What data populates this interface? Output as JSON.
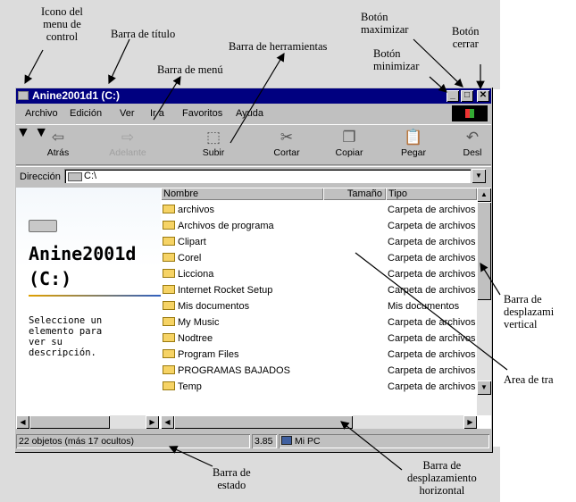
{
  "window": {
    "title": "Anine2001d1 (C:)",
    "buttons": {
      "minimize": "_",
      "maximize": "□",
      "close": "✕"
    }
  },
  "menu": [
    "Archivo",
    "Edición",
    "Ver",
    "Ir a",
    "Favoritos",
    "Ayuda"
  ],
  "toolbar": [
    {
      "label": "Atrás",
      "icon": "back-arrow-icon",
      "glyph": "⇦",
      "disabled": false
    },
    {
      "label": "Adelante",
      "icon": "forward-arrow-icon",
      "glyph": "⇨",
      "disabled": true
    },
    {
      "label": "Subir",
      "icon": "up-folder-icon",
      "glyph": "⬚",
      "disabled": false
    },
    {
      "label": "Cortar",
      "icon": "scissors-icon",
      "glyph": "✂",
      "disabled": false
    },
    {
      "label": "Copiar",
      "icon": "copy-icon",
      "glyph": "❐",
      "disabled": false
    },
    {
      "label": "Pegar",
      "icon": "paste-icon",
      "glyph": "📋",
      "disabled": false
    },
    {
      "label": "Desl",
      "icon": "undo-icon",
      "glyph": "↶",
      "disabled": false
    }
  ],
  "address": {
    "label": "Dirección",
    "value": "C:\\"
  },
  "webview": {
    "heading_line1": "Anine2001d",
    "heading_line2": "(C:)",
    "description": "Seleccione un\nelemento para\nver su\ndescripción."
  },
  "columns": {
    "name": "Nombre",
    "size": "Tamaño",
    "type": "Tipo"
  },
  "files": [
    {
      "name": "archivos",
      "type": "Carpeta de archivos"
    },
    {
      "name": "Archivos de programa",
      "type": "Carpeta de archivos"
    },
    {
      "name": "Clipart",
      "type": "Carpeta de archivos"
    },
    {
      "name": "Corel",
      "type": "Carpeta de archivos"
    },
    {
      "name": "Licciona",
      "type": "Carpeta de archivos"
    },
    {
      "name": "Internet Rocket Setup",
      "type": "Carpeta de archivos"
    },
    {
      "name": "Mis documentos",
      "type": "Mis documentos"
    },
    {
      "name": "My Music",
      "type": "Carpeta de archivos"
    },
    {
      "name": "Nodtree",
      "type": "Carpeta de archivos"
    },
    {
      "name": "Program Files",
      "type": "Carpeta de archivos"
    },
    {
      "name": "PROGRAMAS BAJADOS",
      "type": "Carpeta de archivos"
    },
    {
      "name": "Temp",
      "type": "Carpeta de archivos"
    }
  ],
  "status": {
    "objects": "22 objetos (más 17 ocultos)",
    "size": "3.85",
    "location": "Mi PC"
  },
  "annotations": {
    "control_menu_icon": "Icono del\nmenu de\ncontrol",
    "title_bar": "Barra de título",
    "toolbar": "Barra de herramientas",
    "menu_bar": "Barra de menú",
    "maximize_button": "Botón\nmaximizar",
    "close_button": "Botón\ncerrar",
    "minimize_button": "Botón\nminimizar",
    "vertical_scrollbar": "Barra de\ndesplazami\nvertical",
    "work_area": "Area de tra",
    "status_bar": "Barra de\nestado",
    "horizontal_scrollbar": "Barra de\ndesplazamiento\nhorizontal"
  }
}
